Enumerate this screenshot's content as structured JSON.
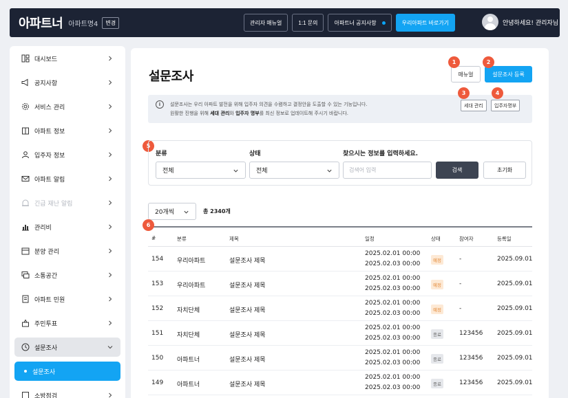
{
  "header": {
    "logo": "아파트너",
    "apt_name": "아파트명4",
    "change_label": "변경",
    "buttons": {
      "admin_manual": "관리자 매뉴얼",
      "inquiry": "1:1 문의",
      "notice": "아파트너 공지사항",
      "go_app": "우리아파트 바로가기"
    },
    "greeting": "안녕하세요! 관리자님"
  },
  "sidebar": {
    "items": [
      {
        "label": "대시보드",
        "icon": "dashboard-icon"
      },
      {
        "label": "공지사항",
        "icon": "megaphone-icon"
      },
      {
        "label": "서비스 관리",
        "icon": "gear-icon"
      },
      {
        "label": "아파트 정보",
        "icon": "building-icon"
      },
      {
        "label": "입주자 정보",
        "icon": "person-icon"
      },
      {
        "label": "아파트 알림",
        "icon": "mail-icon"
      },
      {
        "label": "긴급 재난 알림",
        "icon": "alert-icon"
      },
      {
        "label": "관리비",
        "icon": "chart-icon"
      },
      {
        "label": "분양 관리",
        "icon": "calendar-icon"
      },
      {
        "label": "소통공간",
        "icon": "chat-icon"
      },
      {
        "label": "아파트 민원",
        "icon": "document-icon"
      },
      {
        "label": "주민투표",
        "icon": "vote-icon"
      },
      {
        "label": "설문조사",
        "icon": "clock-icon"
      }
    ],
    "sub_item": "설문조사",
    "partial_item": "소방점검"
  },
  "page": {
    "title": "설문조사",
    "manual_label": "매뉴얼",
    "register_label": "설문조사 등록",
    "info_line1": "설문조사는 우리 아파트 발전을 위해 입주자 의견을 수렴하고 결정안을 도출할 수 있는 기능입니다.",
    "info_line2_a": "원활한 진행을 위해 ",
    "info_line2_b": "세대 관리",
    "info_line2_c": "와 ",
    "info_line2_d": "입주자 명부",
    "info_line2_e": "를 최신 정보로 업데이트해 주시기 바랍니다.",
    "household_label": "세대 관리",
    "resident_list_label": "입주자명부"
  },
  "markers": [
    "1",
    "2",
    "3",
    "4",
    "5",
    "6"
  ],
  "filter": {
    "category_label": "분류",
    "category_value": "전체",
    "status_label": "상태",
    "status_value": "전체",
    "search_label": "찾으시는 정보를 입력하세요.",
    "search_placeholder": "검색어 입력",
    "search_button": "검색",
    "reset_button": "초기화"
  },
  "list": {
    "page_size": "20개씩",
    "total": "총 2340개"
  },
  "table": {
    "headers": [
      "#",
      "분류",
      "제목",
      "일정",
      "상태",
      "참여자",
      "등록일"
    ],
    "rows": [
      {
        "no": "154",
        "category": "우리아파트",
        "title": "설문조사 제목",
        "start": "2025.02.01 00:00",
        "end": "2025.02.03 00:00",
        "status": "예정",
        "status_type": "pending",
        "participants": "-",
        "date": "2025.09.01"
      },
      {
        "no": "153",
        "category": "우리아파트",
        "title": "설문조사 제목",
        "start": "2025.02.01 00:00",
        "end": "2025.02.03 00:00",
        "status": "예정",
        "status_type": "pending",
        "participants": "-",
        "date": "2025.09.01"
      },
      {
        "no": "152",
        "category": "자치단체",
        "title": "설문조사 제목",
        "start": "2025.02.01 00:00",
        "end": "2025.02.03 00:00",
        "status": "예정",
        "status_type": "pending",
        "participants": "-",
        "date": "2025.09.01"
      },
      {
        "no": "151",
        "category": "자치단체",
        "title": "설문조사 제목",
        "start": "2025.02.01 00:00",
        "end": "2025.02.03 00:00",
        "status": "종료",
        "status_type": "done",
        "participants": "123456",
        "date": "2025.09.01"
      },
      {
        "no": "150",
        "category": "아파트너",
        "title": "설문조사 제목",
        "start": "2025.02.01 00:00",
        "end": "2025.02.03 00:00",
        "status": "종료",
        "status_type": "done",
        "participants": "123456",
        "date": "2025.09.01"
      },
      {
        "no": "149",
        "category": "아파트너",
        "title": "설문조사 제목",
        "start": "2025.02.01 00:00",
        "end": "2025.02.03 00:00",
        "status": "종료",
        "status_type": "done",
        "participants": "123456",
        "date": "2025.09.01"
      }
    ]
  },
  "colors": {
    "topbar": "#1c2334",
    "accent": "#13a4f3",
    "marker": "#ee5a3c",
    "pending_bg": "#fde9d5",
    "pending_text": "#e38a3b"
  }
}
